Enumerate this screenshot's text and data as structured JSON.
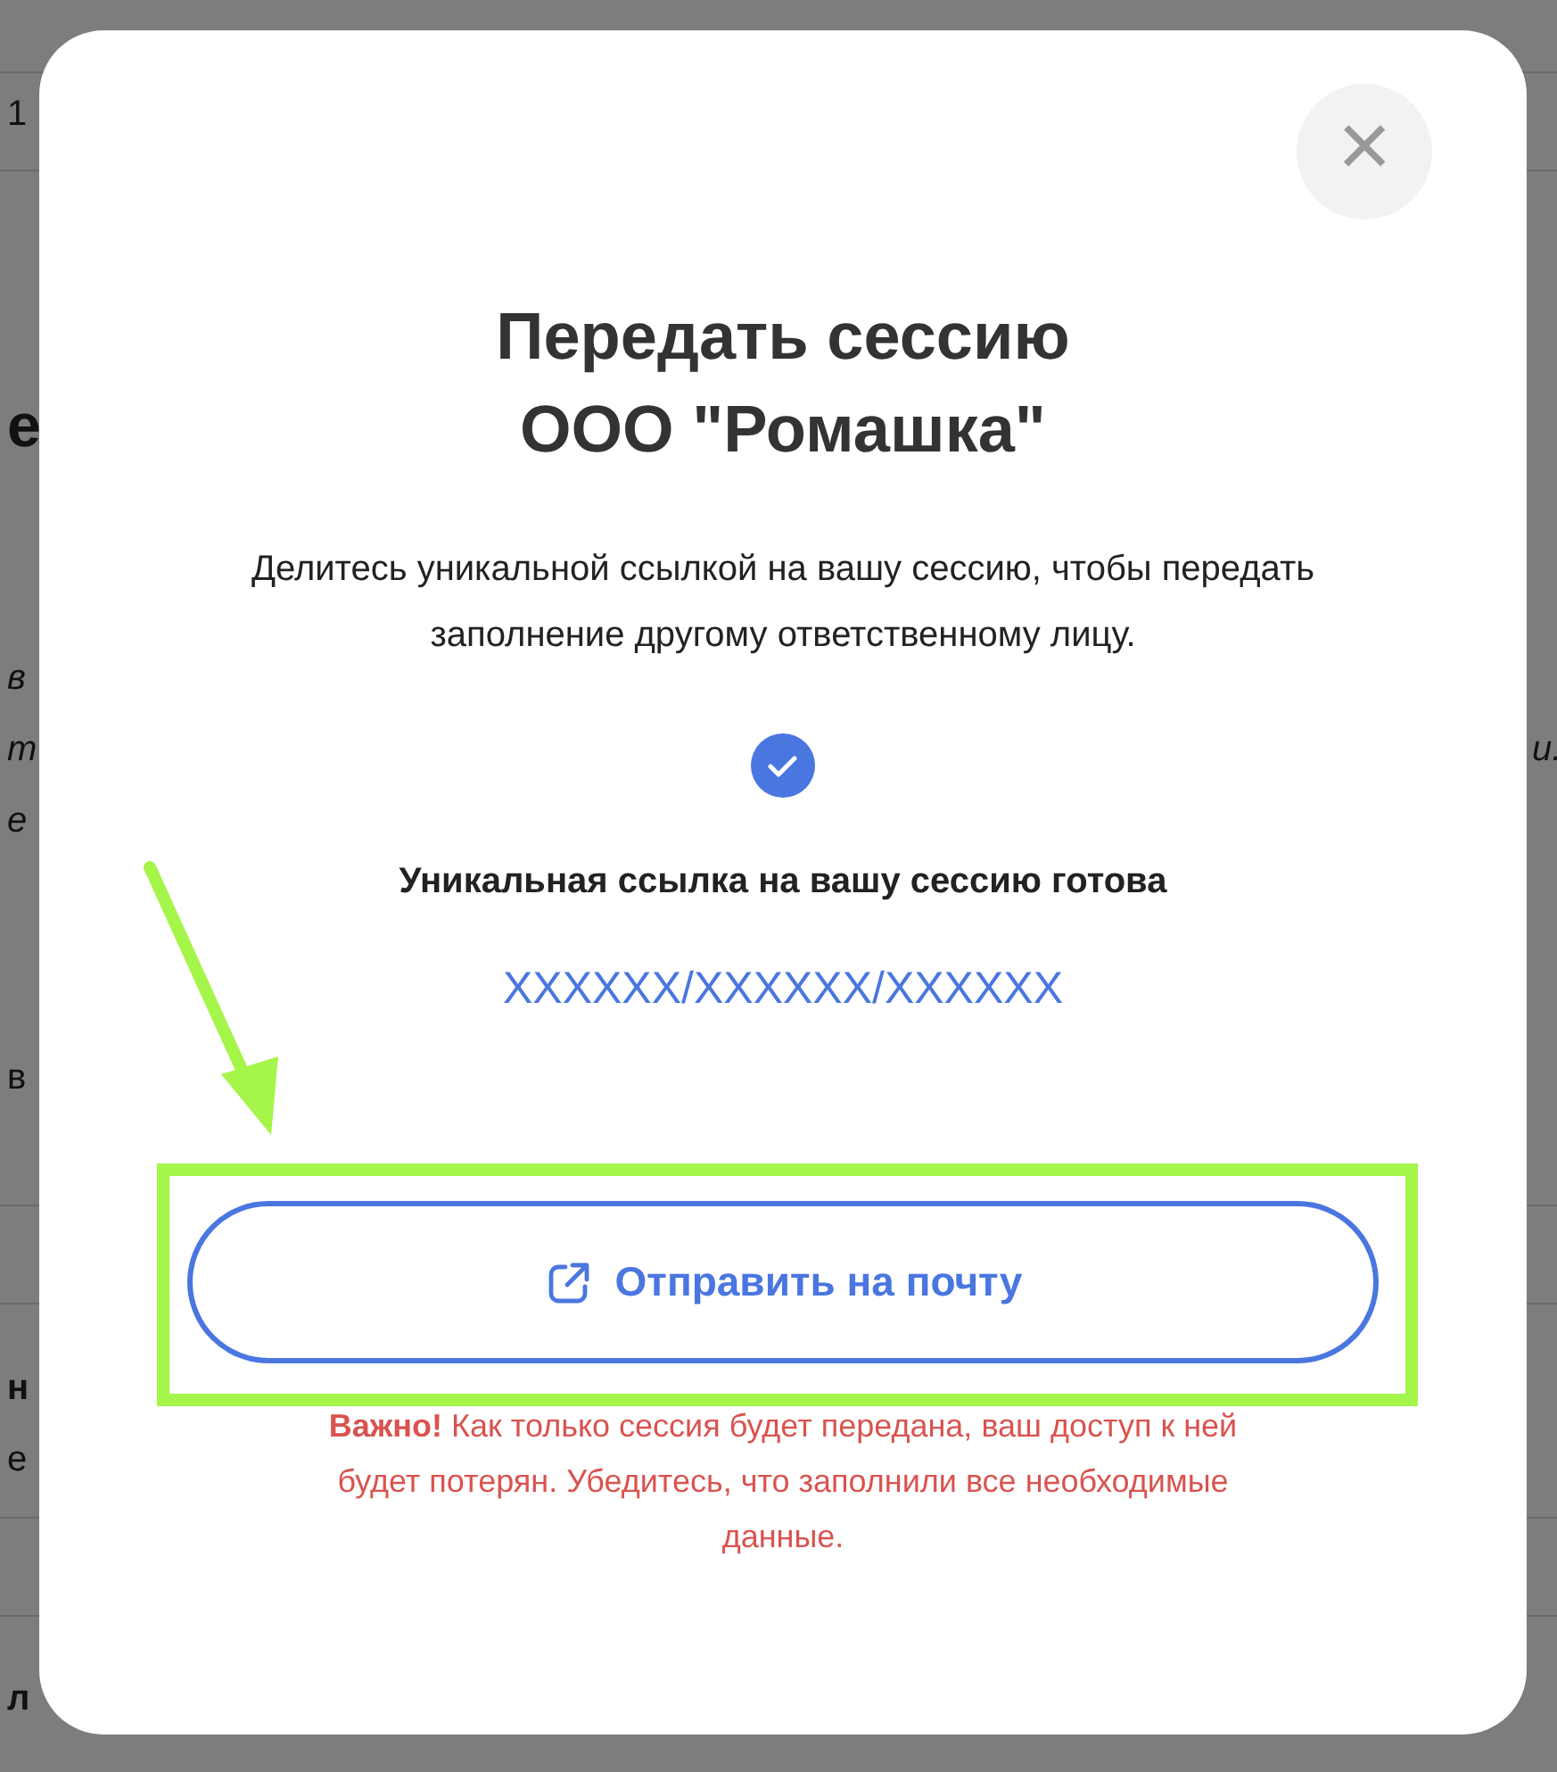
{
  "background": {
    "fragments": [
      {
        "text": "1",
        "kind": "plain"
      },
      {
        "text": "е",
        "kind": "heading"
      },
      {
        "text": "в",
        "kind": "italic"
      },
      {
        "text": "т",
        "kind": "italic"
      },
      {
        "text": "е",
        "kind": "italic"
      },
      {
        "text": "в",
        "kind": "plain"
      },
      {
        "text": "н",
        "kind": "bold"
      },
      {
        "text": "е",
        "kind": "plain"
      },
      {
        "text": "л",
        "kind": "bold"
      }
    ],
    "right_fragments": [
      {
        "text": "и.",
        "kind": "italic"
      }
    ]
  },
  "modal": {
    "close_label": "×",
    "title_lines": [
      "Передать сессию",
      "ООО \"Ромашка\""
    ],
    "description": "Делитесь уникальной ссылкой на вашу сессию, чтобы передать заполнение другому ответственному лицу.",
    "status": "Уникальная ссылка на вашу сессию готова",
    "link": "XXXXXX/XXXXXX/XXXXXX",
    "button": "Отправить на почту",
    "warning": "**Важно!** Как только сессия будет передана, ваш доступ к ней будет потерян. Убедитесь, что заполнили все необходимые данные."
  }
}
